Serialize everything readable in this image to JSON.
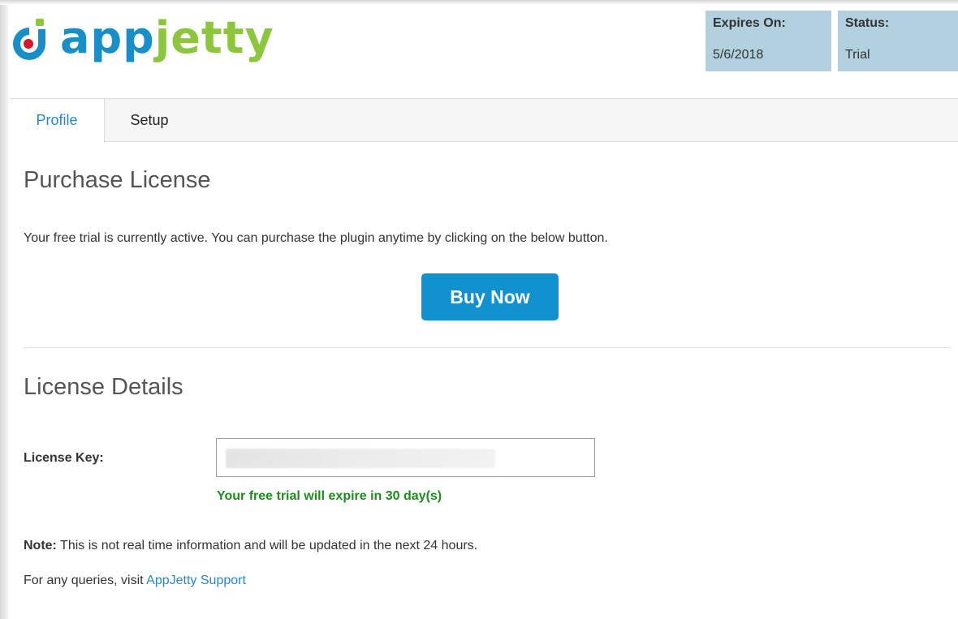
{
  "brand": {
    "logo_app": "app",
    "logo_jetty": "jetty",
    "logo_icon": "appjetty-logo-icon",
    "colors": {
      "blue": "#1a8fc7",
      "green": "#8cc63f",
      "red": "#d6182b"
    }
  },
  "header": {
    "expires": {
      "label": "Expires On:",
      "value": "5/6/2018"
    },
    "status": {
      "label": "Status:",
      "value": "Trial"
    },
    "box_color": "#b2d0de"
  },
  "tabs": [
    {
      "label": "Profile",
      "active": true
    },
    {
      "label": "Setup",
      "active": false
    }
  ],
  "purchase": {
    "title": "Purchase License",
    "message": "Your free trial is currently active. You can purchase the plugin anytime by clicking on the below button.",
    "button_label": "Buy Now",
    "button_color": "#1291cf"
  },
  "license": {
    "title": "License Details",
    "key_label": "License Key:",
    "key_value": "",
    "expire_message": "Your free trial will expire in 30 day(s)",
    "expire_color": "#1f8a1f"
  },
  "footer": {
    "note_label": "Note:",
    "note_text": " This is not real time information and will be updated in the next 24 hours.",
    "queries_text": "For any queries, visit ",
    "support_link": "AppJetty Support"
  }
}
